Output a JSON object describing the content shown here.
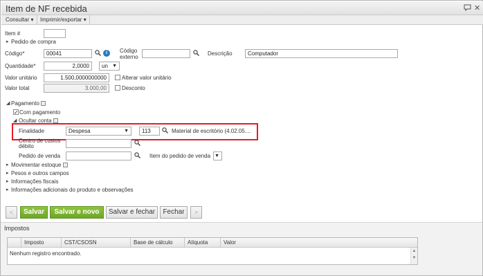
{
  "window": {
    "title": "Item de NF recebida"
  },
  "menu": {
    "consultar": "Consultar",
    "imprimir": "Imprimir/exportar"
  },
  "form": {
    "item_label": "Item #",
    "item_value": "",
    "pedido_compra": "Pedido de compra",
    "codigo_label": "Código*",
    "codigo_value": "00041",
    "codigo_externo_label_1": "Código",
    "codigo_externo_label_2": "externo",
    "codigo_externo_value": "",
    "descricao_label": "Descrição",
    "descricao_value": "Computador",
    "quantidade_label": "Quantidade*",
    "quantidade_value": "2,0000",
    "unidade_value": "un",
    "valor_unitario_label": "Valor unitário",
    "valor_unitario_value": "1.500,0000000000",
    "alterar_valor_unitario": "Alterar valor unitário",
    "valor_total_label": "Valor total",
    "valor_total_value": "3.000,00",
    "desconto": "Desconto"
  },
  "pagamento": {
    "section": "Pagamento",
    "com_pagamento": "Com pagamento",
    "ocultar_conta": "Ocultar conta",
    "finalidade_label": "Finalidade",
    "finalidade_value": "Despesa",
    "conta_codigo": "113",
    "conta_descricao": "Material de escritório (4.02.05....",
    "centro_custos_1": "Centro de custos",
    "centro_custos_2": "débito",
    "pedido_venda_label": "Pedido de venda",
    "item_pedido_venda_label": "Item do pedido de venda"
  },
  "sections": {
    "movimentar_estoque": "Movimentar estoque",
    "pesos": "Pesos e outros campos",
    "fiscais": "Informações fiscais",
    "adicionais": "Informações adicionais do produto e observações"
  },
  "buttons": {
    "prev": "<",
    "salvar": "Salvar",
    "salvar_novo": "Salvar e novo",
    "salvar_fechar": "Salvar e fechar",
    "fechar": "Fechar",
    "next": ">"
  },
  "impostos": {
    "title": "Impostos",
    "columns": [
      "Imposto",
      "CST/CSOSN",
      "Base de cálculo",
      "Alíquota",
      "Valor"
    ],
    "empty": "Nenhum registro encontrado."
  },
  "icons": [
    "chat-icon",
    "close-icon",
    "search-icon",
    "info-icon",
    "dropdown-arrow-icon",
    "expand-triangle-icon"
  ]
}
